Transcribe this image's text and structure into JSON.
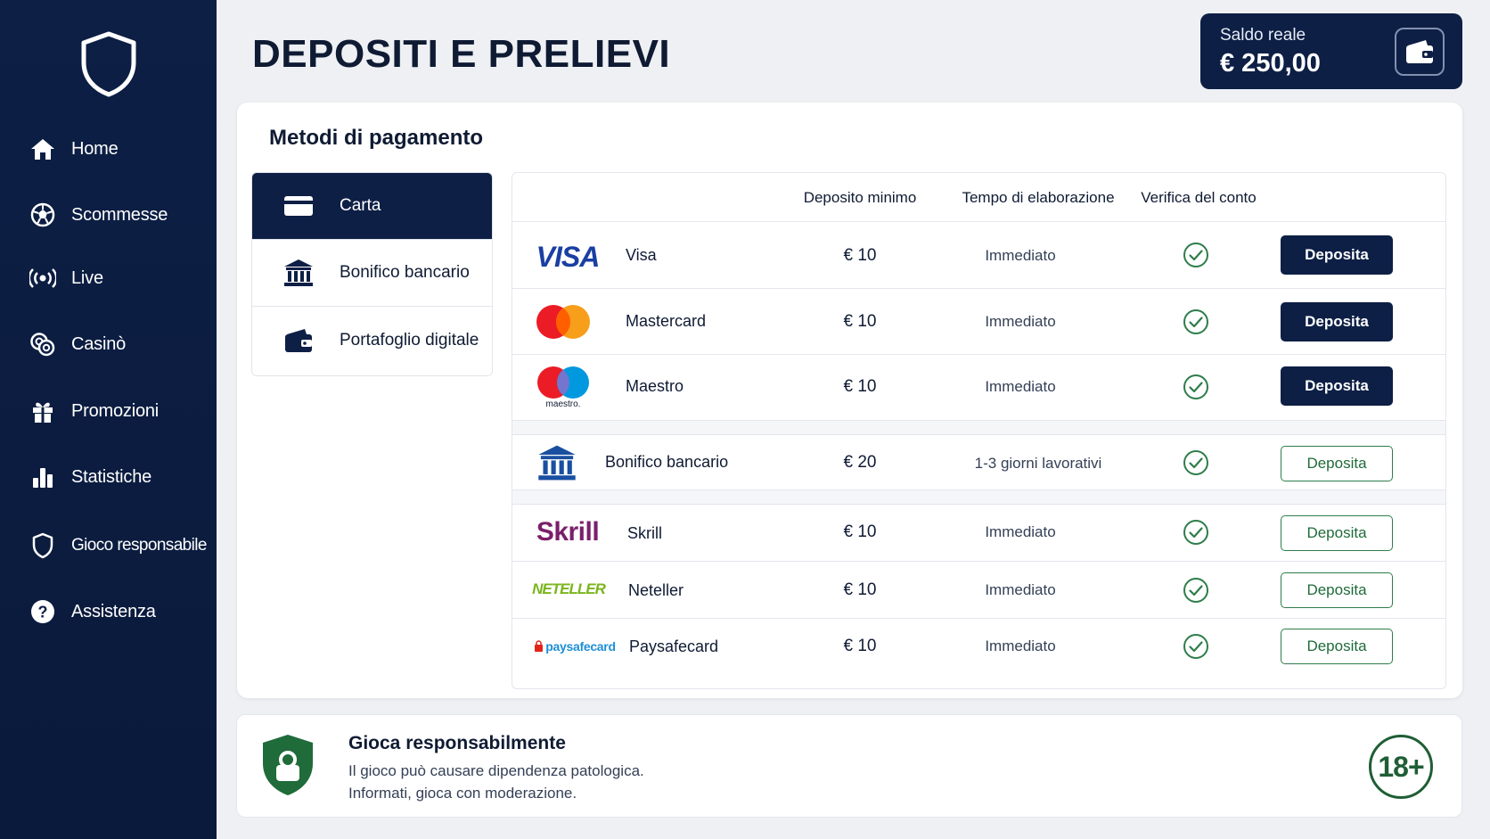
{
  "sidebar": {
    "items": [
      {
        "label": "Home",
        "icon": "home-icon"
      },
      {
        "label": "Scommesse",
        "icon": "soccer-ball-icon"
      },
      {
        "label": "Live",
        "icon": "live-broadcast-icon"
      },
      {
        "label": "Casinò",
        "icon": "casino-chips-icon"
      },
      {
        "label": "Promozioni",
        "icon": "gift-icon"
      },
      {
        "label": "Statistiche",
        "icon": "bar-chart-icon"
      },
      {
        "label": "Gioco responsabile",
        "icon": "shield-icon"
      },
      {
        "label": "Assistenza",
        "icon": "help-icon"
      }
    ]
  },
  "header": {
    "title": "DEPOSITI E PRELIEVI",
    "balance_label": "Saldo reale",
    "balance_value": "€ 250,00"
  },
  "payment": {
    "section_title": "Metodi di pagamento",
    "tabs": [
      {
        "label": "Carta",
        "icon": "credit-card-icon",
        "active": true
      },
      {
        "label": "Bonifico bancario",
        "icon": "bank-icon",
        "active": false
      },
      {
        "label": "Portafoglio digitale",
        "icon": "wallet-icon",
        "active": false
      }
    ],
    "columns": {
      "min_deposit": "Deposito minimo",
      "processing_time": "Tempo di elaborazione",
      "account_verification": "Verifica del conto"
    },
    "rows": [
      {
        "name": "Visa",
        "logo_text": "VISA",
        "min": "€ 10",
        "time": "Immediato",
        "button": "Deposita",
        "style": "dark"
      },
      {
        "name": "Mastercard",
        "min": "€ 10",
        "time": "Immediato",
        "button": "Deposita",
        "style": "dark"
      },
      {
        "name": "Maestro",
        "logo_text": "maestro.",
        "min": "€ 10",
        "time": "Immediato",
        "button": "Deposita",
        "style": "dark"
      },
      {
        "name": "Bonifico bancario",
        "min": "€ 20",
        "time": "1-3 giorni lavorativi",
        "button": "Deposita",
        "style": "outline"
      },
      {
        "name": "Skrill",
        "logo_text": "Skrill",
        "min": "€ 10",
        "time": "Immediato",
        "button": "Deposita",
        "style": "outline"
      },
      {
        "name": "Neteller",
        "logo_text": "NETELLER",
        "min": "€ 10",
        "time": "Immediato",
        "button": "Deposita",
        "style": "outline"
      },
      {
        "name": "Paysafecard",
        "logo_text": "paysafecard",
        "min": "€ 10",
        "time": "Immediato",
        "button": "Deposita",
        "style": "outline"
      }
    ]
  },
  "responsible": {
    "title": "Gioca responsabilmente",
    "line1": "Il gioco può causare dipendenza patologica.",
    "line2": "Informati, gioca con moderazione.",
    "age_badge": "18+"
  },
  "colors": {
    "navy": "#0d1f45",
    "green": "#2e7d4a",
    "visa_blue": "#1a3fa3",
    "skrill_purple": "#7a1f6b",
    "neteller_green": "#7ab51d",
    "paysafe_blue": "#1d8fd6"
  }
}
